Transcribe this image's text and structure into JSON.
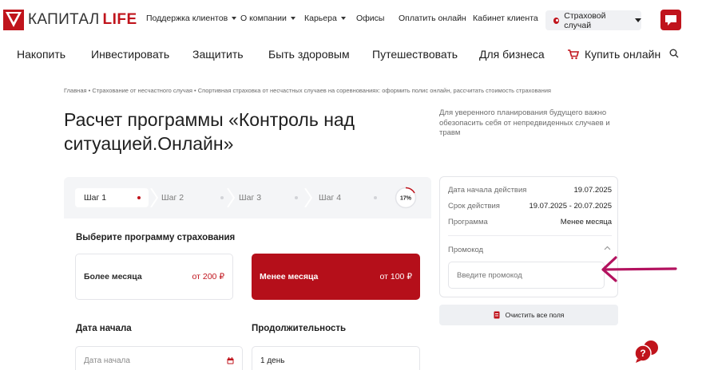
{
  "brand": {
    "name": "КАПИТАЛ",
    "suffix": "LIFE",
    "accent": "#c0141c"
  },
  "topnav": [
    {
      "label": "Поддержка клиентов",
      "dropdown": true
    },
    {
      "label": "О компании",
      "dropdown": true
    },
    {
      "label": "Карьера",
      "dropdown": true
    },
    {
      "label": "Офисы",
      "dropdown": false
    },
    {
      "label": "Оплатить онлайн",
      "dropdown": false
    },
    {
      "label": "Кабинет клиента",
      "dropdown": false
    }
  ],
  "claim_button": {
    "label": "Страховой случай"
  },
  "mainnav": [
    {
      "label": "Накопить"
    },
    {
      "label": "Инвестировать"
    },
    {
      "label": "Защитить"
    },
    {
      "label": "Быть здоровым"
    },
    {
      "label": "Путешествовать"
    },
    {
      "label": "Для бизнеса"
    },
    {
      "label": "Купить онлайн",
      "icon": "cart-icon"
    }
  ],
  "breadcrumb": "Главная • Страхование от несчастного случая • Спортивная страховка от несчастных случаев на соревнованиях: оформить полис онлайн, рассчитать стоимость страхования",
  "page": {
    "title": "Расчет программы «Контроль над ситуацией.Онлайн»",
    "intro": "Для уверенного планирования будущего важно обезопасить себя от непредвиденных случаев и травм"
  },
  "steps": [
    {
      "label": "Шаг 1",
      "active": true
    },
    {
      "label": "Шаг 2",
      "active": false
    },
    {
      "label": "Шаг 3",
      "active": false
    },
    {
      "label": "Шаг 4",
      "active": false
    }
  ],
  "progress": {
    "value": 0.17,
    "label": "17%"
  },
  "program": {
    "heading": "Выберите программу страхования",
    "options": [
      {
        "name": "Более месяца",
        "price": "от 200 ₽",
        "selected": false
      },
      {
        "name": "Менее месяца",
        "price": "от 100 ₽",
        "selected": true
      }
    ]
  },
  "start_date": {
    "heading": "Дата начала",
    "placeholder": "Дата начала"
  },
  "duration": {
    "heading": "Продолжительность",
    "value": "1 день"
  },
  "summary": {
    "rows": [
      {
        "label": "Дата начала действия",
        "value": "19.07.2025"
      },
      {
        "label": "Срок действия",
        "value": "19.07.2025 - 20.07.2025"
      },
      {
        "label": "Программа",
        "value": "Менее месяца"
      }
    ],
    "promo_label": "Промокод",
    "promo_placeholder": "Введите промокод"
  },
  "clear_button": {
    "label": "Очистить все поля"
  },
  "help_chat": {
    "label": "?"
  },
  "colors": {
    "accent": "#c0141c",
    "selected_card": "#b50f1a",
    "annotation_arrow": "#b3125f",
    "panel_bg": "#f4f5f7"
  }
}
